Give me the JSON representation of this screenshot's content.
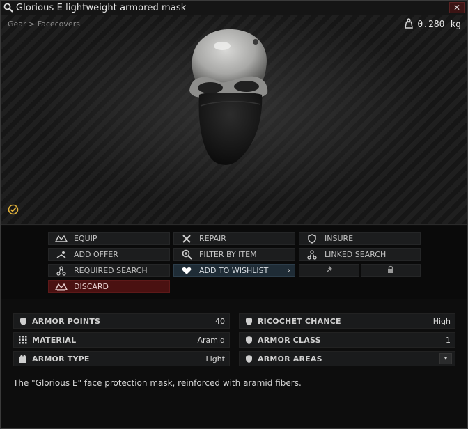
{
  "window": {
    "title": "Glorious E lightweight armored mask",
    "close_label": "✕"
  },
  "preview": {
    "breadcrumb": "Gear > Facecovers",
    "weight": "0.280 kg"
  },
  "actions": {
    "equip": "EQUIP",
    "repair": "REPAIR",
    "insure": "INSURE",
    "add_offer": "ADD OFFER",
    "filter_by_item": "FILTER BY ITEM",
    "linked_search": "LINKED SEARCH",
    "required_search": "REQUIRED SEARCH",
    "add_to_wishlist": "ADD TO WISHLIST",
    "discard": "DISCARD"
  },
  "stats": {
    "armor_points": {
      "label": "ARMOR POINTS",
      "value": "40"
    },
    "ricochet_chance": {
      "label": "RICOCHET CHANCE",
      "value": "High"
    },
    "material": {
      "label": "MATERIAL",
      "value": "Aramid"
    },
    "armor_class": {
      "label": "ARMOR CLASS",
      "value": "1"
    },
    "armor_type": {
      "label": "ARMOR TYPE",
      "value": "Light"
    },
    "armor_areas": {
      "label": "ARMOR AREAS",
      "value": ""
    }
  },
  "description": "The \"Glorious E\" face protection mask, reinforced with aramid fibers."
}
